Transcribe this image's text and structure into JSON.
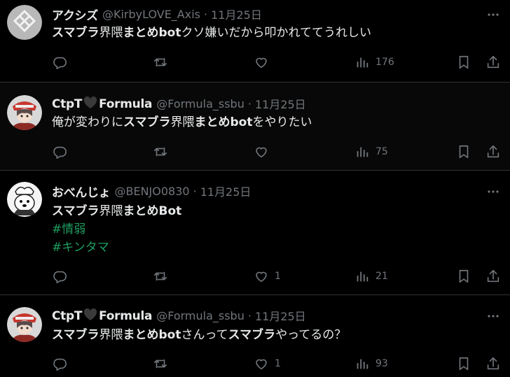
{
  "tweets": [
    {
      "name": "アクシズ",
      "handle": "@KirbyLOVE_Axis",
      "sep": "·",
      "date": "11月25日",
      "segments": [
        {
          "t": "スマブラ",
          "b": true
        },
        {
          "t": "界隈",
          "b": false
        },
        {
          "t": "まとめbot",
          "b": true
        },
        {
          "t": "クソ嫌いだから叩かれててうれしい",
          "b": false
        }
      ],
      "tags": [],
      "likes": "",
      "views": "176"
    },
    {
      "name_left": "CtpT",
      "name_right": "Formula",
      "handle": "@Formula_ssbu",
      "sep": "·",
      "date": "11月25日",
      "segments": [
        {
          "t": "俺が変わりに",
          "b": false
        },
        {
          "t": "スマブラ",
          "b": true
        },
        {
          "t": "界隈",
          "b": false
        },
        {
          "t": "まとめbot",
          "b": true
        },
        {
          "t": "をやりたい",
          "b": false
        }
      ],
      "tags": [],
      "likes": "",
      "views": "75"
    },
    {
      "name": "おべんじょ",
      "handle": "@BENJO0830",
      "sep": "·",
      "date": "11月25日",
      "segments": [
        {
          "t": "スマブラ",
          "b": true
        },
        {
          "t": "界隈",
          "b": false
        },
        {
          "t": "まとめBot",
          "b": true
        }
      ],
      "tags": [
        "#情弱",
        "#キンタマ"
      ],
      "likes": "1",
      "views": "21"
    },
    {
      "name_left": "CtpT",
      "name_right": "Formula",
      "handle": "@Formula_ssbu",
      "sep": "·",
      "date": "11月25日",
      "segments": [
        {
          "t": "スマブラ",
          "b": true
        },
        {
          "t": "界隈",
          "b": false
        },
        {
          "t": "まとめbot",
          "b": true
        },
        {
          "t": "さんって",
          "b": false
        },
        {
          "t": "スマブラ",
          "b": true
        },
        {
          "t": "やってるの？",
          "b": false
        }
      ],
      "tags": [],
      "likes": "1",
      "views": "93"
    }
  ],
  "icons": {
    "reply": "reply-icon",
    "retweet": "retweet-icon",
    "like": "like-icon",
    "views": "views-icon",
    "bookmark": "bookmark-icon",
    "share": "share-icon",
    "more": "more-icon"
  },
  "colors": {
    "background": "#000000",
    "highlight_background": "#080808",
    "text": "#e7e9ea",
    "muted": "#71767b",
    "hashtag": "#1d9e60",
    "divider": "#2f3336"
  }
}
